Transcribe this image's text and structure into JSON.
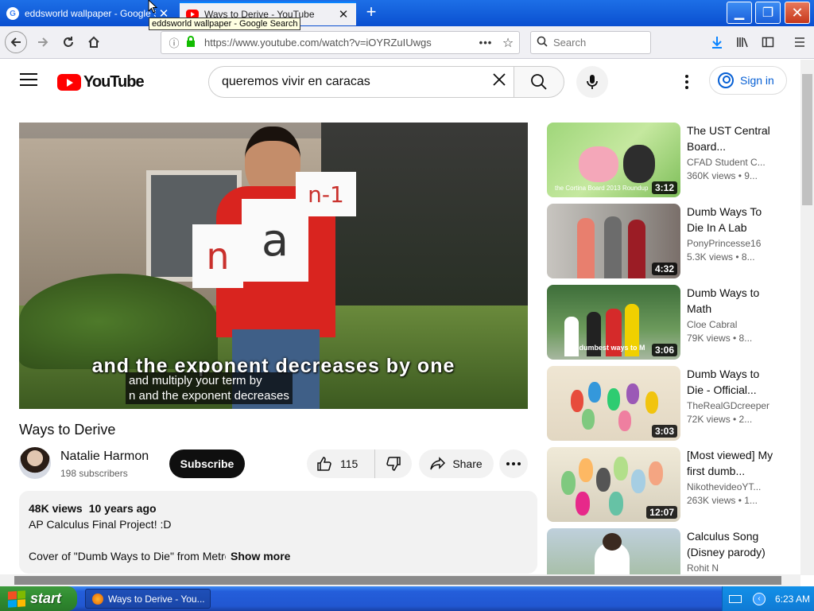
{
  "browser": {
    "tabs": [
      {
        "title": "eddsworld wallpaper - Google Search",
        "favicon": "google-icon",
        "active": false
      },
      {
        "title": "Ways to Derive - YouTube",
        "favicon": "youtube-icon",
        "active": true
      }
    ],
    "tooltip": "eddsworld wallpaper - Google Search",
    "url": "https://www.youtube.com/watch?v=iOYRZuIUwgs",
    "search_placeholder": "Search",
    "page_actions": "•••"
  },
  "youtube": {
    "logo_text": "YouTube",
    "search_query": "queremos vivir en caracas",
    "sign_in": "Sign in",
    "player": {
      "burned_subtitle": "and the exponent decreases by one",
      "cc_lines": [
        "and multiply your term by",
        "n and the exponent decreases"
      ],
      "cards": {
        "n": "n",
        "a": "a",
        "n1": "n-1"
      }
    },
    "video": {
      "title": "Ways to Derive",
      "channel": "Natalie Harmon",
      "subscribers": "198 subscribers",
      "subscribe_label": "Subscribe",
      "likes": "115",
      "share_label": "Share",
      "views": "48K views",
      "age": "10 years ago",
      "description_line1": "AP Calculus Final Project! :D",
      "description_line3": "Cover of \"Dumb Ways to Die\" from Metro",
      "show_more": "Show more"
    },
    "recommendations": [
      {
        "title": "The UST Central Board...",
        "channel": "CFAD Student C...",
        "meta": "360K views • 9...",
        "duration": "3:12"
      },
      {
        "title": "Dumb Ways To Die In A Lab",
        "channel": "PonyPrincesse16",
        "meta": "5.3K views • 8...",
        "duration": "4:32"
      },
      {
        "title": "Dumb Ways to Math",
        "channel": "Cloe Cabral",
        "meta": "79K views • 8...",
        "duration": "3:06"
      },
      {
        "title": "Dumb Ways to Die - Official...",
        "channel": "TheRealGDcreeper",
        "meta": "72K views • 2...",
        "duration": "3:03"
      },
      {
        "title": "[Most viewed] My first dumb...",
        "channel": "NikothevideoYT...",
        "meta": "263K views • 1...",
        "duration": "12:07"
      },
      {
        "title": "Calculus Song (Disney parody)",
        "channel": "Rohit N",
        "meta": "",
        "duration": ""
      }
    ],
    "thumb_captions": {
      "t1": "the Cortina Board 2013 Roundup",
      "t3": "The dumbest ways to M"
    }
  },
  "taskbar": {
    "start_label": "start",
    "task": "Ways to Derive - You...",
    "clock": "6:23 AM"
  },
  "colors": {
    "youtube_red": "#ff0000",
    "link_blue": "#065fd4",
    "xp_blue": "#245edb",
    "xp_green": "#2f8a2f"
  }
}
